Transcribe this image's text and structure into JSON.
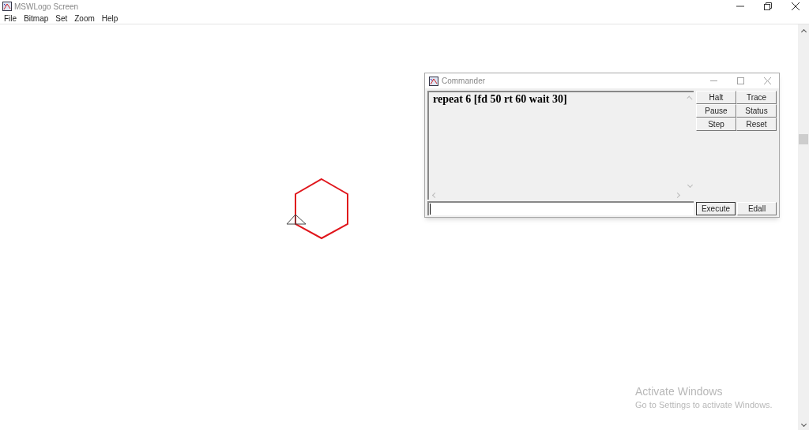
{
  "window": {
    "title": "MSWLogo Screen"
  },
  "menu": [
    "File",
    "Bitmap",
    "Set",
    "Zoom",
    "Help"
  ],
  "commander": {
    "title": "Commander",
    "history": "repeat 6 [fd 50 rt 60 wait 30]",
    "buttons": [
      "Halt",
      "Trace",
      "Pause",
      "Status",
      "Step",
      "Reset"
    ],
    "bottom_buttons": [
      "Execute",
      "Edall"
    ]
  },
  "activation": {
    "title": "Activate Windows",
    "message": "Go to Settings to activate Windows."
  }
}
